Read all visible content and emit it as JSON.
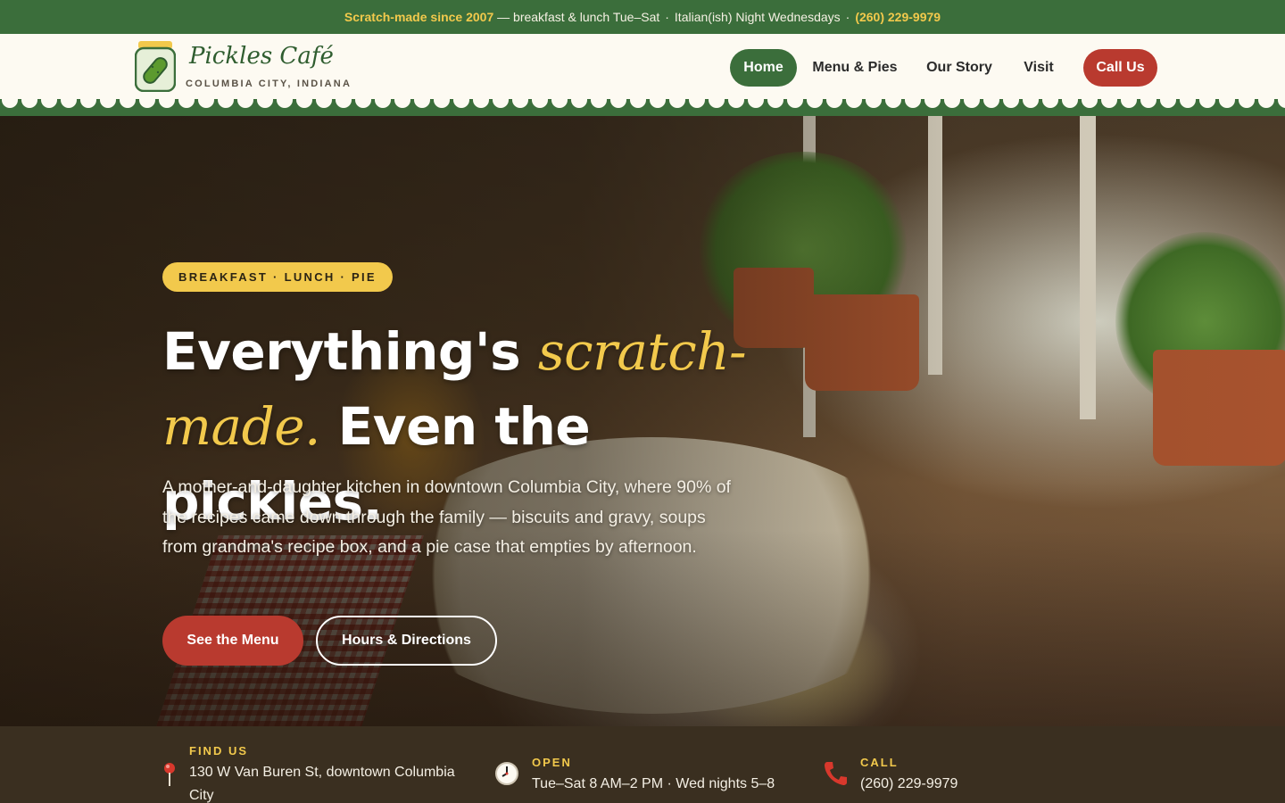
{
  "topbar": {
    "highlight": "Scratch-made since 2007",
    "text1": "— breakfast & lunch Tue–Sat",
    "sep": "·",
    "text2": "Italian(ish) Night Wednesdays",
    "phone": "(260) 229-9979",
    "highlight_color": "#f2c94c",
    "background_color": "#3b6e3b"
  },
  "header": {
    "logo_icon": "pickle-jar-icon",
    "brand_name": "Pickles Café",
    "brand_location": "COLUMBIA CITY, INDIANA",
    "nav": {
      "home": "Home",
      "menu": "Menu & Pies",
      "story": "Our Story",
      "visit": "Visit",
      "call": "Call Us"
    },
    "active_nav": "Home",
    "accent_green": "#3b6e3b",
    "accent_red": "#b93a2f"
  },
  "hero": {
    "badge": "BREAKFAST · LUNCH · PIE",
    "headline_part1": "Everything's ",
    "headline_accent": "scratch-made.",
    "headline_part2": " Even the pickles.",
    "intro": "A mother-and-daughter kitchen in downtown Columbia City, where 90% of the recipes came down through the family — biscuits and gravy, soups from grandma's recipe box, and a pie case that empties by afternoon.",
    "primary_button": "See the Menu",
    "secondary_button": "Hours & Directions"
  },
  "info": {
    "find": {
      "icon": "map-pin-icon",
      "label": "FIND US",
      "value": "130 W Van Buren St, downtown Columbia City"
    },
    "open": {
      "icon": "clock-icon",
      "label": "OPEN",
      "value": "Tue–Sat 8 AM–2 PM · Wed nights 5–8"
    },
    "call": {
      "icon": "phone-icon",
      "label": "CALL",
      "value": "(260) 229-9979"
    }
  }
}
